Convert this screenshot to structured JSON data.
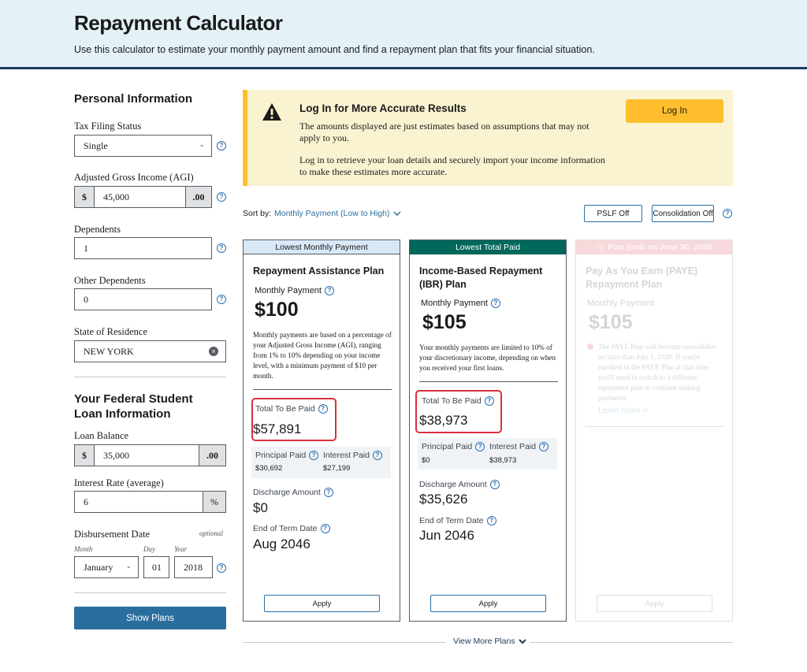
{
  "header": {
    "title": "Repayment Calculator",
    "subtitle": "Use this calculator to estimate your monthly payment amount and find a repayment plan that fits your financial situation."
  },
  "personal": {
    "title": "Personal Information",
    "tax_label": "Tax Filing Status",
    "tax_value": "Single",
    "agi_label": "Adjusted Gross Income (AGI)",
    "agi_prefix": "$",
    "agi_value": "45,000",
    "agi_suffix": ".00",
    "dependents_label": "Dependents",
    "dependents_value": "1",
    "other_label": "Other Dependents",
    "other_value": "0",
    "state_label": "State of Residence",
    "state_value": "NEW YORK"
  },
  "loan": {
    "title": "Your Federal Student Loan Information",
    "balance_label": "Loan Balance",
    "balance_prefix": "$",
    "balance_value": "35,000",
    "balance_suffix": ".00",
    "rate_label": "Interest Rate (average)",
    "rate_value": "6",
    "rate_suffix": "%",
    "date_label": "Disbursement Date",
    "optional": "optional",
    "month_label": "Month",
    "day_label": "Day",
    "year_label": "Year",
    "month_value": "January",
    "day_value": "01",
    "year_value": "2018",
    "show_plans": "Show Plans"
  },
  "alert": {
    "title": "Log In for More Accurate Results",
    "p1": "The amounts displayed are just estimates based on assumptions that may not apply to you.",
    "p2": "Log in to retrieve your loan details and securely import your income information to make these estimates more accurate.",
    "login": "Log In"
  },
  "sort": {
    "label": "Sort by:",
    "value": "Monthly Payment (Low to High)",
    "pslf": "PSLF Off",
    "consolidation": "Consolidation Off"
  },
  "cards": [
    {
      "badge": "Lowest Monthly Payment",
      "name": "Repayment Assistance Plan",
      "monthly_label": "Monthly Payment",
      "monthly": "$100",
      "desc": "Monthly payments are based on a percentage of your Adjusted Gross Income (AGI), ranging from 1% to 10% depending on your income level, with a minimum payment of $10 per month.",
      "total_label": "Total To Be Paid",
      "total": "$57,891",
      "principal_label": "Principal Paid",
      "principal": "$30,692",
      "interest_label": "Interest Paid",
      "interest": "$27,199",
      "discharge_label": "Discharge Amount",
      "discharge": "$0",
      "end_label": "End of Term Date",
      "end": "Aug 2046",
      "apply": "Apply"
    },
    {
      "badge": "Lowest Total Paid",
      "name": "Income-Based Repayment (IBR) Plan",
      "monthly_label": "Monthly Payment",
      "monthly": "$105",
      "desc": "Your monthly payments are limited to 10% of your discretionary income, depending on when you received your first loans.",
      "total_label": "Total To Be Paid",
      "total": "$38,973",
      "principal_label": "Principal Paid",
      "principal": "$0",
      "interest_label": "Interest Paid",
      "interest": "$38,973",
      "discharge_label": "Discharge Amount",
      "discharge": "$35,626",
      "end_label": "End of Term Date",
      "end": "Jun 2046",
      "apply": "Apply"
    },
    {
      "badge": "Plan Ends on June 30, 2028",
      "name": "Pay As You Earn (PAYE) Repayment Plan",
      "monthly_label": "Monthly Payment",
      "monthly": "$105",
      "desc": "The PAYE Plan will become unavailable no later than July 1, 2028. If you're enrolled in the PAYE Plan at that time, you'll need to switch to a different repayment plan to continue making payments.",
      "learn_more": "Learn more >",
      "apply": "Apply"
    }
  ],
  "view_more": "View More Plans",
  "colors": {
    "header_bg": "#e4f2f8",
    "primary": "#2a6e9e",
    "alert_bg": "#faf3d1",
    "warning": "#ffbe2e",
    "teal": "#00675b",
    "highlight": "#d8313b"
  }
}
